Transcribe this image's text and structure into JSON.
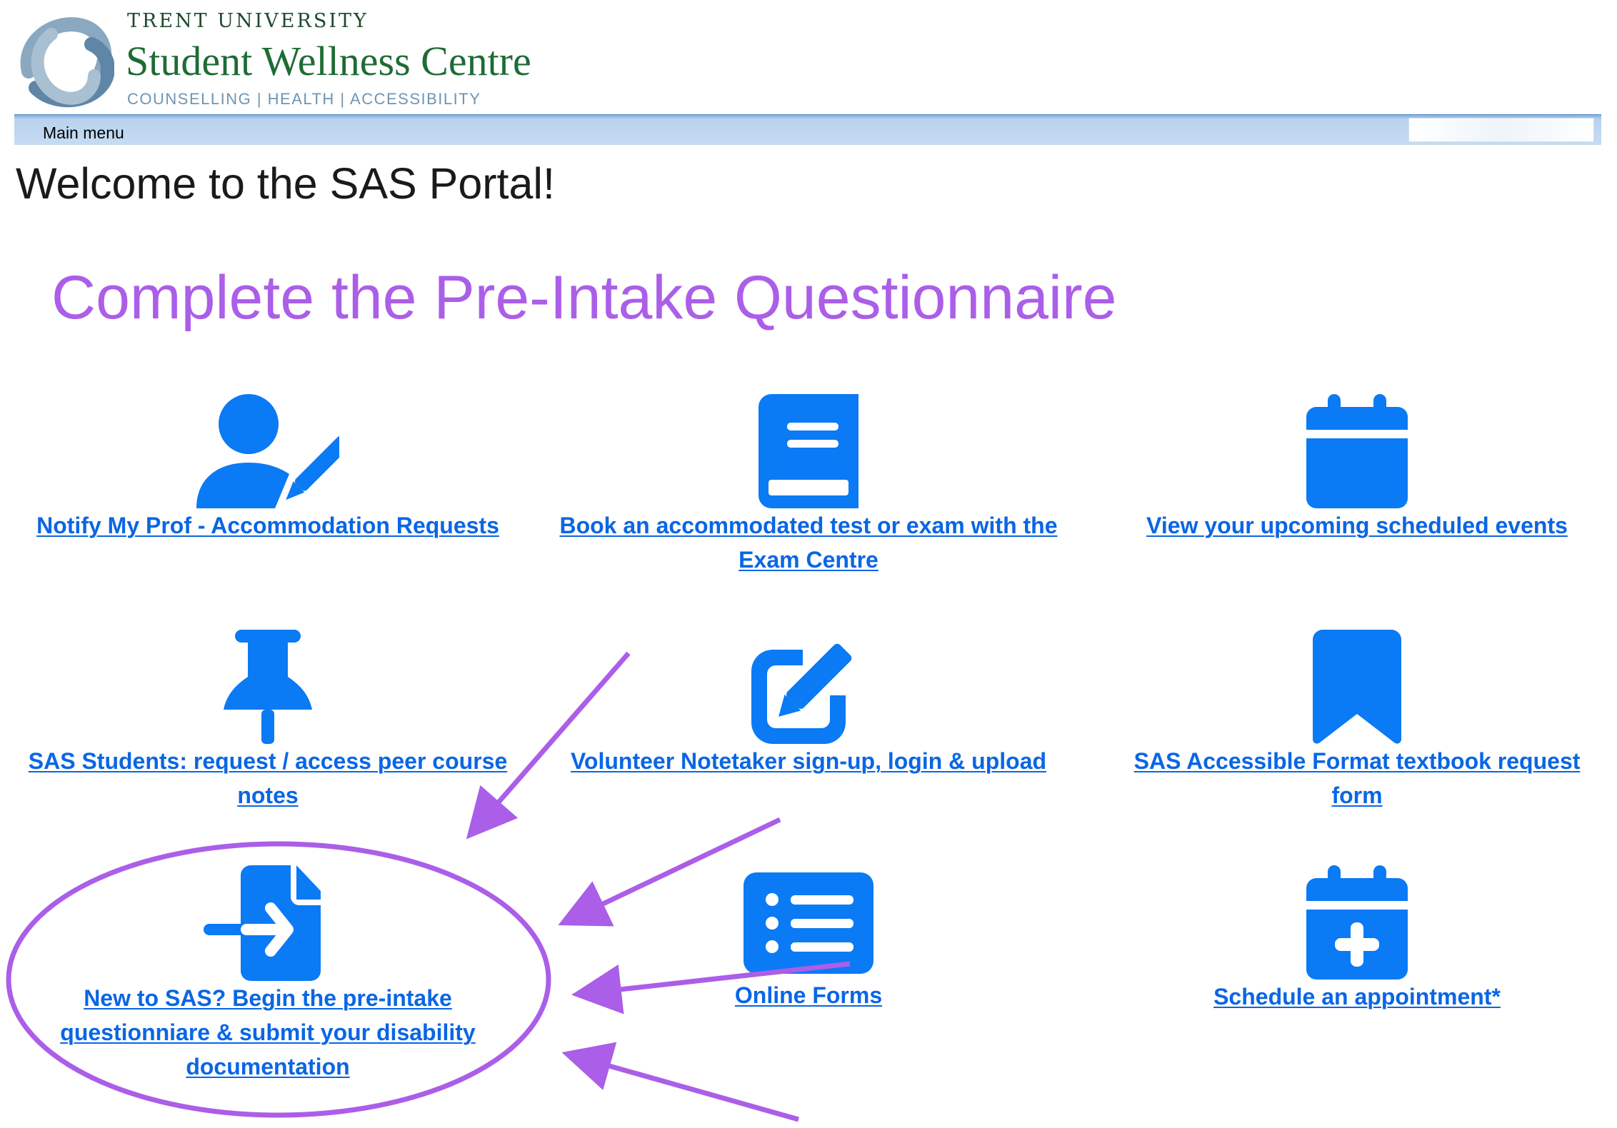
{
  "header": {
    "university": "TRENT UNIVERSITY",
    "centre_name": "Student Wellness Centre",
    "subtitle": "COUNSELLING | HEALTH | ACCESSIBILITY",
    "logo_icon": "trent-knot-logo-icon"
  },
  "menubar": {
    "label": "Main menu"
  },
  "page": {
    "welcome": "Welcome to the SAS Portal!"
  },
  "annotation": {
    "title": "Complete the Pre-Intake Questionnaire",
    "color": "#ab5ee8"
  },
  "tiles": [
    {
      "icon": "user-pen-icon",
      "label": "Notify My Prof - Accommodation Requests"
    },
    {
      "icon": "book-icon",
      "label": "Book an accommodated test or exam with the Exam Centre"
    },
    {
      "icon": "calendar-icon",
      "label": "View your upcoming scheduled events"
    },
    {
      "icon": "thumbtack-icon",
      "label": "SAS Students: request / access peer course notes"
    },
    {
      "icon": "pen-to-square-icon",
      "label": "Volunteer Notetaker sign-up, login & upload"
    },
    {
      "icon": "bookmark-icon",
      "label": "SAS Accessible Format textbook request form"
    },
    {
      "icon": "file-import-icon",
      "label": "New to SAS? Begin the pre-intake questionniare & submit your disability documentation"
    },
    {
      "icon": "list-icon",
      "label": "Online Forms"
    },
    {
      "icon": "calendar-plus-icon",
      "label": "Schedule an appointment*"
    }
  ],
  "colors": {
    "link": "#0a66e4",
    "icon": "#0a7af5",
    "brand_green": "#1f6b35",
    "menubar": "#c5dcf2"
  }
}
